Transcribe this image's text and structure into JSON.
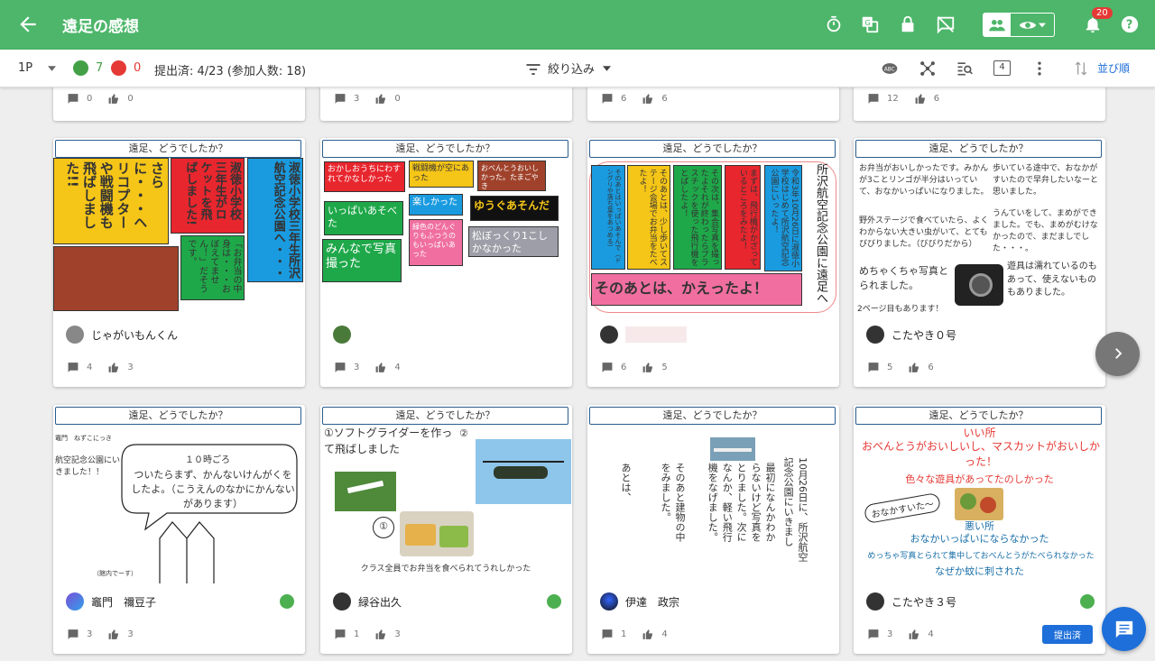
{
  "appbar": {
    "title": "遠足の感想",
    "notification_count": "20",
    "color": "#4db66a"
  },
  "toolbar": {
    "page_selector": "1P",
    "positive_count": "7",
    "negative_count": "0",
    "submission_status": "提出済: 4/23 (参加人数: 18)",
    "filter_label": "絞り込み",
    "layout_count": "4",
    "sort_label": "並び順"
  },
  "prev_row": [
    {
      "comments": "0",
      "likes": "0"
    },
    {
      "comments": "3",
      "likes": "0"
    },
    {
      "comments": "6",
      "likes": "6"
    },
    {
      "comments": "12",
      "likes": "6"
    }
  ],
  "cards": [
    {
      "title": "遠足、どうでしたか？",
      "author": "じゃがいもんくん",
      "comments": "4",
      "likes": "3",
      "notes": {
        "n1": "淑徳小学校三年生所沢航空記念公園へ・・・",
        "n2": "淑徳小学校三年生がロケットを飛ばしました!",
        "n3": "さらに・・・ヘリコプターや戦闘機も飛ばしました!!",
        "n4": "「お弁当の中身は・・・おぼえてません！」だそうです。"
      }
    },
    {
      "title": "遠足、どうでしたか？",
      "author": "",
      "comments": "3",
      "likes": "4",
      "notes": {
        "n1": "おかしおうちにわすれてかなしかった",
        "n2": "戦闘機が空にあった",
        "n3": "おべんとうおいしかった。たまごやき",
        "n4": "楽しかった",
        "n5": "いっぱいあそべた",
        "n6": "ゆうぐあそんだ",
        "n7": "緑色のどんぐりもふつうのもいっぱいあった",
        "n8": "みんなで写真撮った",
        "n9": "松ぼっくり1こしかなかった"
      }
    },
    {
      "title": "遠足、どうでしたか？",
      "author": "",
      "comments": "6",
      "likes": "5",
      "notes": {
        "n1": "所沢航空記念公園に遠足へ",
        "n2": "令和3年10月26日に淑徳小学校はじめて所沢航空記念公園にいったよ！",
        "n3": "まずは、飛行機がかざっているところをみたよ！",
        "n4": "その次は、集合写真を撮ったよそれが終わったらプラスチックを使った飛行機をとばしたよ！",
        "n5": "そのあとは、少し歩いてステージ会場でお弁当をたべたよ！",
        "n6": "そのあとはいっぱいあそんで（ドングリや落ち葉をあつめる）",
        "n7": "そのあとは、かえったよ！"
      }
    },
    {
      "title": "遠足、どうでしたか？",
      "author": "こたやき０号",
      "comments": "5",
      "likes": "6",
      "text": {
        "t1": "お弁当がおいしかったです。みかんが3ことリンゴが半分はいっていて、おなかいっぱいになりました。",
        "t2": "歩いている途中で、おなかがすいたので早弁したいなーと思いました。",
        "t3": "野外ステージで食べていたら、よくわからない大きい虫がいて、とてもびびりました。（びびりだから）",
        "t4": "うんていをして、まめができました。でも、まめがむけなかったので、まだましでした・・・。",
        "t5": "めちゃくちゃ写真とられました。",
        "t6": "遊具は濡れているのもあって、使えないものもありました。",
        "t7": "2ページ目もあります！"
      }
    },
    {
      "title": "遠足、どうでしたか？",
      "author": "竈門　禰豆子",
      "comments": "3",
      "likes": "3",
      "text": {
        "t1": "竈門　ねずこにっき",
        "t2": "航空記念公園にいきました！！",
        "t3": "１０時ごろ",
        "t4": "ついたらまず、かんないけんがくをしたよ。（こうえんのなかにかんないがあります）",
        "t5": "（館内でーす）"
      }
    },
    {
      "title": "遠足、どうでしたか？",
      "author": "緑谷出久",
      "comments": "1",
      "likes": "3",
      "text": {
        "t1": "①ソフトグライダーを作って飛ばしました",
        "t2": "②",
        "t3": "①",
        "t4": "クラス全員でお弁当を食べられてうれしかった"
      }
    },
    {
      "title": "遠足、どうでしたか？",
      "author": "伊達　政宗",
      "comments": "1",
      "likes": "4",
      "text": {
        "t1": "10月26日に、所沢航空記念公園にいきました。",
        "t2": "最初になんかわからないけど写真をとりました。次になんか、軽い飛行機をなげました。",
        "t3": "そのあと建物の中をみました。",
        "t4": "あとは、"
      }
    },
    {
      "title": "遠足、どうでしたか？",
      "author": "こたやき３号",
      "comments": "3",
      "likes": "4",
      "submitted_label": "提出済",
      "text": {
        "t1": "いい所",
        "t2": "おべんとうがおいしいし、マスカットがおいしかった！",
        "t3": "色々な遊具があってたのしかった",
        "t4": "おなかすいた〜",
        "t5": "悪い所",
        "t6": "おなかいっぱいにならなかった",
        "t7": "めっちゃ写真とられて集中しておべんとうがたべられなかった",
        "t8": "なぜか蚊に刺された"
      }
    }
  ]
}
